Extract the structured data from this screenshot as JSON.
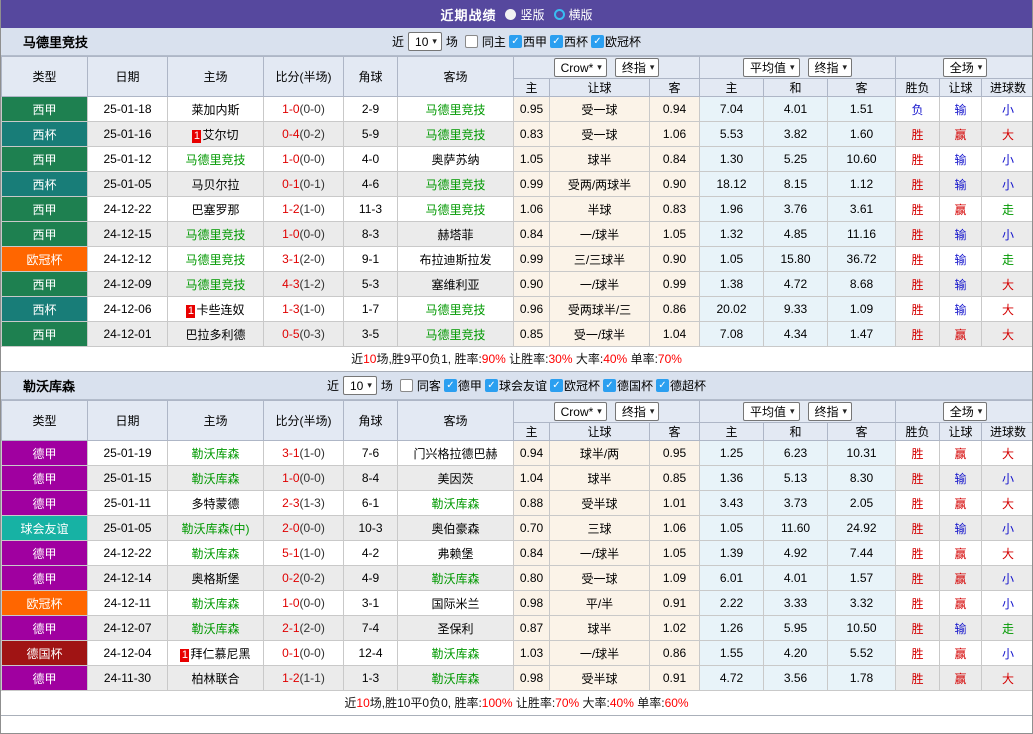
{
  "titlebar": {
    "title": "近期战绩",
    "radios": [
      {
        "label": "竖版",
        "selected": true
      },
      {
        "label": "横版",
        "selected": false
      }
    ]
  },
  "icons": {
    "dropdown_chevron": "▾",
    "check": "✓",
    "red_card": "1"
  },
  "filter_labels": {
    "near": "近",
    "games": "场"
  },
  "table_header": {
    "base": [
      "类型",
      "日期",
      "主场",
      "比分(半场)",
      "角球",
      "客场"
    ],
    "dropdown_groups": [
      [
        "Crow*",
        "终指"
      ],
      [
        "平均值",
        "终指"
      ],
      [
        "全场"
      ]
    ],
    "sub": [
      "主",
      "让球",
      "客",
      "主",
      "和",
      "客",
      "胜负",
      "让球",
      "进球数"
    ]
  },
  "type_colors": {
    "西甲": "#1e8050",
    "西杯": "#187d78",
    "欧冠杯": "#ff6600",
    "德甲": "#a000a0",
    "球会友谊": "#17b2a4",
    "德国杯": "#a01414"
  },
  "sections": [
    {
      "team": "马德里竞技",
      "filter": {
        "count": "10",
        "checkboxes": [
          {
            "label": "同主",
            "checked": false
          },
          {
            "label": "西甲",
            "checked": true
          },
          {
            "label": "西杯",
            "checked": true
          },
          {
            "label": "欧冠杯",
            "checked": true
          }
        ]
      },
      "rows": [
        {
          "type": "西甲",
          "date": "25-01-18",
          "home": "莱加内斯",
          "home_green": false,
          "home_rc": false,
          "score": "1-0",
          "half": "(0-0)",
          "corner": "2-9",
          "away": "马德里竞技",
          "away_green": true,
          "away_rc": false,
          "o1": "0.95",
          "hc": "受一球",
          "o2": "0.94",
          "a1": "7.04",
          "a2": "4.01",
          "a3": "1.51",
          "r1": "负",
          "r2": "输",
          "r3": "小"
        },
        {
          "type": "西杯",
          "date": "25-01-16",
          "home": "艾尔切",
          "home_green": false,
          "home_rc": true,
          "score": "0-4",
          "half": "(0-2)",
          "corner": "5-9",
          "away": "马德里竞技",
          "away_green": true,
          "away_rc": false,
          "o1": "0.83",
          "hc": "受一球",
          "o2": "1.06",
          "a1": "5.53",
          "a2": "3.82",
          "a3": "1.60",
          "r1": "胜",
          "r2": "赢",
          "r3": "大"
        },
        {
          "type": "西甲",
          "date": "25-01-12",
          "home": "马德里竞技",
          "home_green": true,
          "home_rc": false,
          "score": "1-0",
          "half": "(0-0)",
          "corner": "4-0",
          "away": "奥萨苏纳",
          "away_green": false,
          "away_rc": false,
          "o1": "1.05",
          "hc": "球半",
          "o2": "0.84",
          "a1": "1.30",
          "a2": "5.25",
          "a3": "10.60",
          "r1": "胜",
          "r2": "输",
          "r3": "小"
        },
        {
          "type": "西杯",
          "date": "25-01-05",
          "home": "马贝尔拉",
          "home_green": false,
          "home_rc": false,
          "score": "0-1",
          "half": "(0-1)",
          "corner": "4-6",
          "away": "马德里竞技",
          "away_green": true,
          "away_rc": false,
          "o1": "0.99",
          "hc": "受两/两球半",
          "o2": "0.90",
          "a1": "18.12",
          "a2": "8.15",
          "a3": "1.12",
          "r1": "胜",
          "r2": "输",
          "r3": "小"
        },
        {
          "type": "西甲",
          "date": "24-12-22",
          "home": "巴塞罗那",
          "home_green": false,
          "home_rc": false,
          "score": "1-2",
          "half": "(1-0)",
          "corner": "11-3",
          "away": "马德里竞技",
          "away_green": true,
          "away_rc": false,
          "o1": "1.06",
          "hc": "半球",
          "o2": "0.83",
          "a1": "1.96",
          "a2": "3.76",
          "a3": "3.61",
          "r1": "胜",
          "r2": "赢",
          "r3": "走"
        },
        {
          "type": "西甲",
          "date": "24-12-15",
          "home": "马德里竞技",
          "home_green": true,
          "home_rc": false,
          "score": "1-0",
          "half": "(0-0)",
          "corner": "8-3",
          "away": "赫塔菲",
          "away_green": false,
          "away_rc": false,
          "o1": "0.84",
          "hc": "一/球半",
          "o2": "1.05",
          "a1": "1.32",
          "a2": "4.85",
          "a3": "11.16",
          "r1": "胜",
          "r2": "输",
          "r3": "小"
        },
        {
          "type": "欧冠杯",
          "date": "24-12-12",
          "home": "马德里竞技",
          "home_green": true,
          "home_rc": false,
          "score": "3-1",
          "half": "(2-0)",
          "corner": "9-1",
          "away": "布拉迪斯拉发",
          "away_green": false,
          "away_rc": false,
          "o1": "0.99",
          "hc": "三/三球半",
          "o2": "0.90",
          "a1": "1.05",
          "a2": "15.80",
          "a3": "36.72",
          "r1": "胜",
          "r2": "输",
          "r3": "走"
        },
        {
          "type": "西甲",
          "date": "24-12-09",
          "home": "马德里竞技",
          "home_green": true,
          "home_rc": false,
          "score": "4-3",
          "half": "(1-2)",
          "corner": "5-3",
          "away": "塞维利亚",
          "away_green": false,
          "away_rc": false,
          "o1": "0.90",
          "hc": "一/球半",
          "o2": "0.99",
          "a1": "1.38",
          "a2": "4.72",
          "a3": "8.68",
          "r1": "胜",
          "r2": "输",
          "r3": "大"
        },
        {
          "type": "西杯",
          "date": "24-12-06",
          "home": "卡些连奴",
          "home_green": false,
          "home_rc": true,
          "score": "1-3",
          "half": "(1-0)",
          "corner": "1-7",
          "away": "马德里竞技",
          "away_green": true,
          "away_rc": false,
          "o1": "0.96",
          "hc": "受两球半/三",
          "o2": "0.86",
          "a1": "20.02",
          "a2": "9.33",
          "a3": "1.09",
          "r1": "胜",
          "r2": "输",
          "r3": "大"
        },
        {
          "type": "西甲",
          "date": "24-12-01",
          "home": "巴拉多利德",
          "home_green": false,
          "home_rc": false,
          "score": "0-5",
          "half": "(0-3)",
          "corner": "3-5",
          "away": "马德里竞技",
          "away_green": true,
          "away_rc": false,
          "o1": "0.85",
          "hc": "受一/球半",
          "o2": "1.04",
          "a1": "7.08",
          "a2": "4.34",
          "a3": "1.47",
          "r1": "胜",
          "r2": "赢",
          "r3": "大"
        }
      ],
      "summary": [
        {
          "text": "近",
          "red": false
        },
        {
          "text": "10",
          "red": true
        },
        {
          "text": "场,胜9平0负1, 胜率:",
          "red": false
        },
        {
          "text": "90%",
          "red": true
        },
        {
          "text": " 让胜率:",
          "red": false
        },
        {
          "text": "30%",
          "red": true
        },
        {
          "text": " 大率:",
          "red": false
        },
        {
          "text": "40%",
          "red": true
        },
        {
          "text": " 单率:",
          "red": false
        },
        {
          "text": "70%",
          "red": true
        }
      ]
    },
    {
      "team": "勒沃库森",
      "filter": {
        "count": "10",
        "checkboxes": [
          {
            "label": "同客",
            "checked": false
          },
          {
            "label": "德甲",
            "checked": true
          },
          {
            "label": "球会友谊",
            "checked": true
          },
          {
            "label": "欧冠杯",
            "checked": true
          },
          {
            "label": "德国杯",
            "checked": true
          },
          {
            "label": "德超杯",
            "checked": true
          }
        ]
      },
      "rows": [
        {
          "type": "德甲",
          "date": "25-01-19",
          "home": "勒沃库森",
          "home_green": true,
          "home_rc": false,
          "score": "3-1",
          "half": "(1-0)",
          "corner": "7-6",
          "away": "门兴格拉德巴赫",
          "away_green": false,
          "away_rc": false,
          "o1": "0.94",
          "hc": "球半/两",
          "o2": "0.95",
          "a1": "1.25",
          "a2": "6.23",
          "a3": "10.31",
          "r1": "胜",
          "r2": "赢",
          "r3": "大"
        },
        {
          "type": "德甲",
          "date": "25-01-15",
          "home": "勒沃库森",
          "home_green": true,
          "home_rc": false,
          "score": "1-0",
          "half": "(0-0)",
          "corner": "8-4",
          "away": "美因茨",
          "away_green": false,
          "away_rc": false,
          "o1": "1.04",
          "hc": "球半",
          "o2": "0.85",
          "a1": "1.36",
          "a2": "5.13",
          "a3": "8.30",
          "r1": "胜",
          "r2": "输",
          "r3": "小"
        },
        {
          "type": "德甲",
          "date": "25-01-11",
          "home": "多特蒙德",
          "home_green": false,
          "home_rc": false,
          "score": "2-3",
          "half": "(1-3)",
          "corner": "6-1",
          "away": "勒沃库森",
          "away_green": true,
          "away_rc": false,
          "o1": "0.88",
          "hc": "受半球",
          "o2": "1.01",
          "a1": "3.43",
          "a2": "3.73",
          "a3": "2.05",
          "r1": "胜",
          "r2": "赢",
          "r3": "大"
        },
        {
          "type": "球会友谊",
          "date": "25-01-05",
          "home": "勒沃库森(中)",
          "home_green": true,
          "home_rc": false,
          "score": "2-0",
          "half": "(0-0)",
          "corner": "10-3",
          "away": "奥伯豪森",
          "away_green": false,
          "away_rc": false,
          "o1": "0.70",
          "hc": "三球",
          "o2": "1.06",
          "a1": "1.05",
          "a2": "11.60",
          "a3": "24.92",
          "r1": "胜",
          "r2": "输",
          "r3": "小"
        },
        {
          "type": "德甲",
          "date": "24-12-22",
          "home": "勒沃库森",
          "home_green": true,
          "home_rc": false,
          "score": "5-1",
          "half": "(1-0)",
          "corner": "4-2",
          "away": "弗赖堡",
          "away_green": false,
          "away_rc": false,
          "o1": "0.84",
          "hc": "一/球半",
          "o2": "1.05",
          "a1": "1.39",
          "a2": "4.92",
          "a3": "7.44",
          "r1": "胜",
          "r2": "赢",
          "r3": "大"
        },
        {
          "type": "德甲",
          "date": "24-12-14",
          "home": "奥格斯堡",
          "home_green": false,
          "home_rc": false,
          "score": "0-2",
          "half": "(0-2)",
          "corner": "4-9",
          "away": "勒沃库森",
          "away_green": true,
          "away_rc": false,
          "o1": "0.80",
          "hc": "受一球",
          "o2": "1.09",
          "a1": "6.01",
          "a2": "4.01",
          "a3": "1.57",
          "r1": "胜",
          "r2": "赢",
          "r3": "小"
        },
        {
          "type": "欧冠杯",
          "date": "24-12-11",
          "home": "勒沃库森",
          "home_green": true,
          "home_rc": false,
          "score": "1-0",
          "half": "(0-0)",
          "corner": "3-1",
          "away": "国际米兰",
          "away_green": false,
          "away_rc": false,
          "o1": "0.98",
          "hc": "平/半",
          "o2": "0.91",
          "a1": "2.22",
          "a2": "3.33",
          "a3": "3.32",
          "r1": "胜",
          "r2": "赢",
          "r3": "小"
        },
        {
          "type": "德甲",
          "date": "24-12-07",
          "home": "勒沃库森",
          "home_green": true,
          "home_rc": false,
          "score": "2-1",
          "half": "(2-0)",
          "corner": "7-4",
          "away": "圣保利",
          "away_green": false,
          "away_rc": false,
          "o1": "0.87",
          "hc": "球半",
          "o2": "1.02",
          "a1": "1.26",
          "a2": "5.95",
          "a3": "10.50",
          "r1": "胜",
          "r2": "输",
          "r3": "走"
        },
        {
          "type": "德国杯",
          "date": "24-12-04",
          "home": "拜仁慕尼黑",
          "home_green": false,
          "home_rc": true,
          "score": "0-1",
          "half": "(0-0)",
          "corner": "12-4",
          "away": "勒沃库森",
          "away_green": true,
          "away_rc": false,
          "o1": "1.03",
          "hc": "一/球半",
          "o2": "0.86",
          "a1": "1.55",
          "a2": "4.20",
          "a3": "5.52",
          "r1": "胜",
          "r2": "赢",
          "r3": "小"
        },
        {
          "type": "德甲",
          "date": "24-11-30",
          "home": "柏林联合",
          "home_green": false,
          "home_rc": false,
          "score": "1-2",
          "half": "(1-1)",
          "corner": "1-3",
          "away": "勒沃库森",
          "away_green": true,
          "away_rc": false,
          "o1": "0.98",
          "hc": "受半球",
          "o2": "0.91",
          "a1": "4.72",
          "a2": "3.56",
          "a3": "1.78",
          "r1": "胜",
          "r2": "赢",
          "r3": "大"
        }
      ],
      "summary": [
        {
          "text": "近",
          "red": false
        },
        {
          "text": "10",
          "red": true
        },
        {
          "text": "场,胜10平0负0, 胜率:",
          "red": false
        },
        {
          "text": "100%",
          "red": true
        },
        {
          "text": " 让胜率:",
          "red": false
        },
        {
          "text": "70%",
          "red": true
        },
        {
          "text": " 大率:",
          "red": false
        },
        {
          "text": "40%",
          "red": true
        },
        {
          "text": " 单率:",
          "red": false
        },
        {
          "text": "60%",
          "red": true
        }
      ]
    }
  ]
}
